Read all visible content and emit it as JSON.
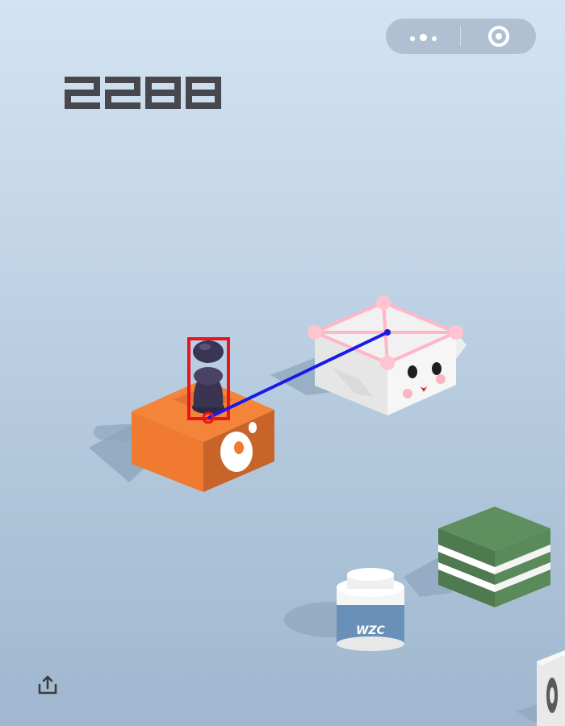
{
  "game": {
    "score": "2288",
    "colors": {
      "score": "#46484d",
      "player": "#3a3450",
      "bbox": "#e8141e",
      "aim_line": "#1a1ae8",
      "target_outline": "#ffb6c6"
    }
  },
  "blocks": {
    "bottle_label": "WZC"
  },
  "menu": {
    "more_icon": "more-dots-icon",
    "close_icon": "target-ring-icon",
    "share_icon": "share-upload-icon"
  }
}
